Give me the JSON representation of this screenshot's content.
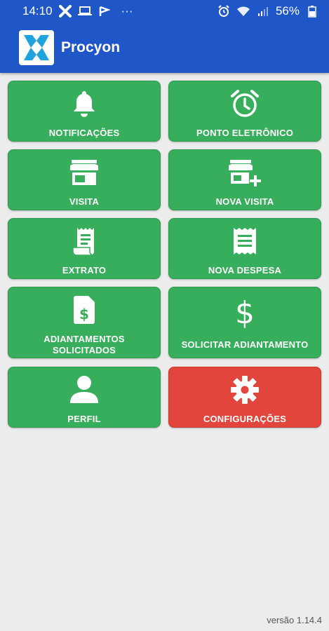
{
  "status_bar": {
    "time": "14:10",
    "overflow": "···",
    "battery": "56%",
    "icons_left": [
      "cross-app-icon",
      "laptop-icon",
      "flag-icon"
    ],
    "icons_right": [
      "alarm-icon",
      "wifi-icon",
      "signal-icon",
      "battery-icon"
    ]
  },
  "app": {
    "title": "Procyon",
    "logo": "procyon-logo"
  },
  "menu": [
    {
      "id": "notificacoes",
      "label": "NOTIFICAÇÕES",
      "icon": "bell-icon",
      "color": "#37ae5b"
    },
    {
      "id": "ponto-eletronico",
      "label": "PONTO ELETRÔNICO",
      "icon": "alarm-clock-icon",
      "color": "#37ae5b"
    },
    {
      "id": "visita",
      "label": "VISITA",
      "icon": "store-icon",
      "color": "#37ae5b"
    },
    {
      "id": "nova-visita",
      "label": "NOVA VISITA",
      "icon": "store-plus-icon",
      "color": "#37ae5b"
    },
    {
      "id": "extrato",
      "label": "EXTRATO",
      "icon": "receipt-icon",
      "color": "#37ae5b"
    },
    {
      "id": "nova-despesa",
      "label": "NOVA DESPESA",
      "icon": "receipt-lines-icon",
      "color": "#37ae5b"
    },
    {
      "id": "adiantamentos-solicitados",
      "label": "ADIANTAMENTOS\nSOLICITADOS",
      "icon": "file-dollar-icon",
      "color": "#37ae5b"
    },
    {
      "id": "solicitar-adiantamento",
      "label": "SOLICITAR ADIANTAMENTO",
      "icon": "dollar-icon",
      "color": "#37ae5b"
    },
    {
      "id": "perfil",
      "label": "PERFIL",
      "icon": "user-icon",
      "color": "#37ae5b"
    },
    {
      "id": "configuracoes",
      "label": "CONFIGURAÇÕES",
      "icon": "gear-icon",
      "color": "#e2453b"
    }
  ],
  "version": "versão 1.14.4"
}
